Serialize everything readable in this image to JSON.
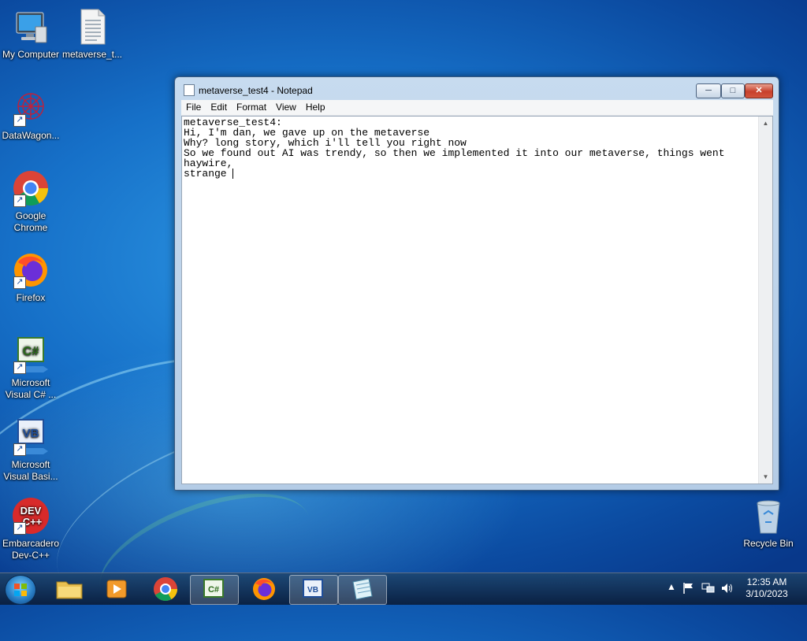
{
  "desktop": {
    "icons": [
      {
        "label": "My Computer"
      },
      {
        "label": "metaverse_t..."
      },
      {
        "label": "DataWagon..."
      },
      {
        "label": "Google Chrome"
      },
      {
        "label": "Firefox"
      },
      {
        "label": "Microsoft Visual C# ..."
      },
      {
        "label": "Microsoft Visual Basi..."
      },
      {
        "label": "Embarcadero Dev-C++"
      },
      {
        "label": "Recycle Bin"
      }
    ]
  },
  "notepad": {
    "title": "metaverse_test4 - Notepad",
    "menu": [
      "File",
      "Edit",
      "Format",
      "View",
      "Help"
    ],
    "lines": [
      "metaverse_test4:",
      "Hi, I'm dan, we gave up on the metaverse",
      "Why? long story, which i'll tell you right now",
      "So we found out AI was trendy, so then we implemented it into our metaverse, things went",
      "haywire,",
      "strange "
    ]
  },
  "taskbar": {
    "clock_time": "12:35 AM",
    "clock_date": "3/10/2023",
    "apps": [
      "explorer",
      "media-player",
      "chrome",
      "visual-csharp",
      "firefox",
      "visual-basic",
      "notepad"
    ]
  },
  "colors": {
    "close_button": "#c7402c",
    "desktop": "#1670c8"
  }
}
